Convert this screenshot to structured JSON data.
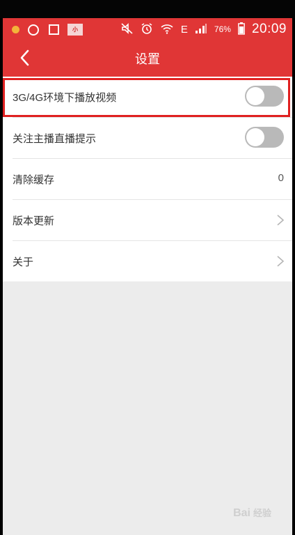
{
  "status_bar": {
    "app_badge": "小",
    "battery": "76%",
    "network": "E",
    "time": "20:09"
  },
  "header": {
    "title": "设置"
  },
  "settings": {
    "items": [
      {
        "label": "3G/4G环境下播放视频",
        "toggle_on": false
      },
      {
        "label": "关注主播直播提示",
        "toggle_on": false
      },
      {
        "label": "清除缓存",
        "value": "0"
      },
      {
        "label": "版本更新"
      },
      {
        "label": "关于"
      }
    ]
  },
  "watermark": {
    "logo": "Bai",
    "text": "经验"
  },
  "colors": {
    "accent": "#e03636",
    "highlight_border": "#e02020",
    "toggle_off": "#b9b9b9",
    "background": "#ececec"
  }
}
